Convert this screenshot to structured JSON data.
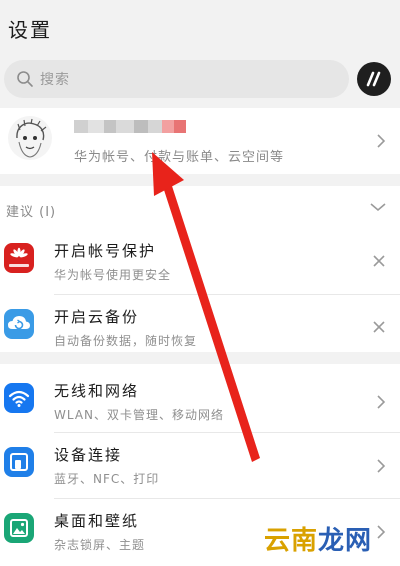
{
  "header": {
    "title": "设置"
  },
  "search": {
    "placeholder": "搜索",
    "hicloud_logo": "hicloud-logo-icon"
  },
  "account": {
    "subtitle": "华为帐号、付款与账单、云空间等",
    "avatar": "user-avatar-sketch",
    "name_obscured": true
  },
  "suggestions": {
    "header": "建议 (I)",
    "items": [
      {
        "title": "开启帐号保护",
        "subtitle": "华为帐号使用更安全",
        "icon": "huawei-logo-icon",
        "icon_color": "#d8211f"
      },
      {
        "title": "开启云备份",
        "subtitle": "自动备份数据，随时恢复",
        "icon": "cloud-backup-icon",
        "icon_color": "#3a9be6"
      }
    ]
  },
  "settings": {
    "items": [
      {
        "title": "无线和网络",
        "subtitle": "WLAN、双卡管理、移动网络",
        "icon": "wifi-icon",
        "icon_color": "#1677f0"
      },
      {
        "title": "设备连接",
        "subtitle": "蓝牙、NFC、打印",
        "icon": "device-connect-icon",
        "icon_color": "#1f7fe8"
      },
      {
        "title": "桌面和壁纸",
        "subtitle": "杂志锁屏、主题",
        "icon": "wallpaper-icon",
        "icon_color": "#1aa676"
      }
    ]
  },
  "annotation": {
    "arrow_color": "#e8231b"
  },
  "watermark": {
    "part1": "云南",
    "part2": "龙网"
  }
}
